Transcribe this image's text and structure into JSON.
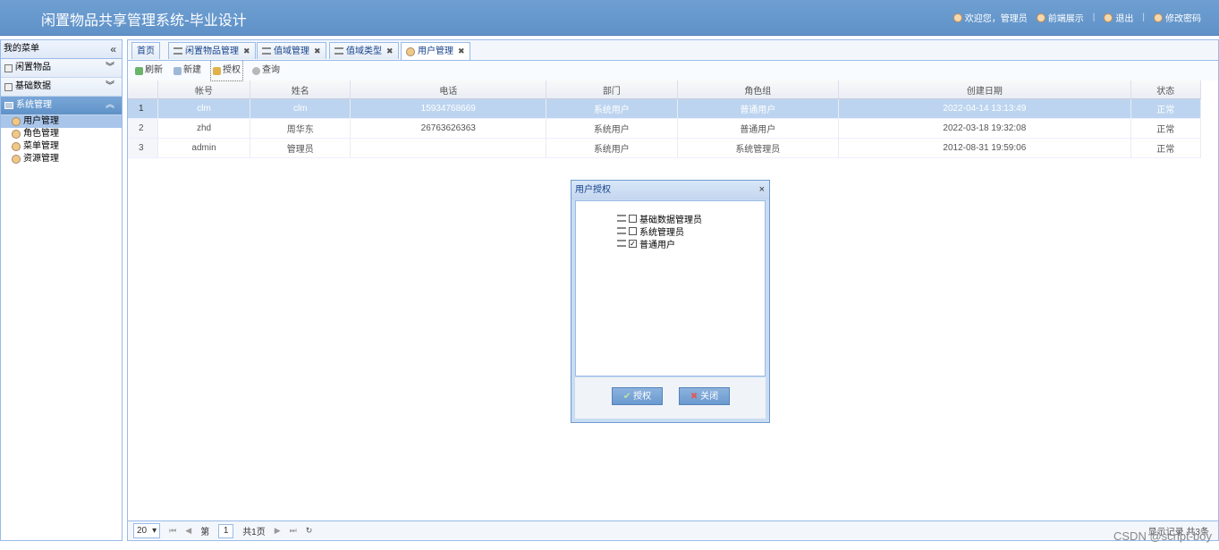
{
  "header": {
    "title": "闲置物品共享管理系统-毕业设计",
    "welcome": "欢迎您，管理员",
    "front": "前端展示",
    "logout": "退出",
    "change_pwd": "修改密码",
    "separator": "|"
  },
  "sidebar": {
    "title": "我的菜单",
    "collapse_icon": "«",
    "sections": [
      {
        "label": "闲置物品",
        "icon": "list-icon"
      },
      {
        "label": "基础数据",
        "icon": "database-icon"
      },
      {
        "label": "系统管理",
        "icon": "monitor-icon"
      }
    ],
    "items": [
      "用户管理",
      "角色管理",
      "菜单管理",
      "资源管理"
    ]
  },
  "tabs": [
    "首页",
    "闲置物品管理",
    "值域管理",
    "值域类型",
    "用户管理"
  ],
  "toolbar": {
    "refresh": "刷新",
    "new": "新建",
    "authorize": "授权",
    "query": "查询"
  },
  "grid": {
    "columns": [
      "帐号",
      "姓名",
      "电话",
      "部门",
      "角色组",
      "创建日期",
      "状态"
    ],
    "rows": [
      {
        "n": "1",
        "account": "clm",
        "name": "clm",
        "phone": "15934768669",
        "dept": "系统用户",
        "role": "普通用户",
        "created": "2022-04-14 13:13:49",
        "status": "正常"
      },
      {
        "n": "2",
        "account": "zhd",
        "name": "周华东",
        "phone": "26763626363",
        "dept": "系统用户",
        "role": "普通用户",
        "created": "2022-03-18 19:32:08",
        "status": "正常"
      },
      {
        "n": "3",
        "account": "admin",
        "name": "管理员",
        "phone": "",
        "dept": "系统用户",
        "role": "系统管理员",
        "created": "2012-08-31 19:59:06",
        "status": "正常"
      }
    ]
  },
  "pager": {
    "size": "20",
    "page_prefix": "第",
    "page": "1",
    "total": "共1页",
    "info": "显示记录 共3条"
  },
  "dialog": {
    "title": "用户授权",
    "close": "×",
    "roles": [
      {
        "label": "基础数据管理员",
        "checked": false
      },
      {
        "label": "系统管理员",
        "checked": false
      },
      {
        "label": "普通用户",
        "checked": true
      }
    ],
    "ok": "授权",
    "cancel": "关闭"
  },
  "watermark": "CSDN @script-boy"
}
